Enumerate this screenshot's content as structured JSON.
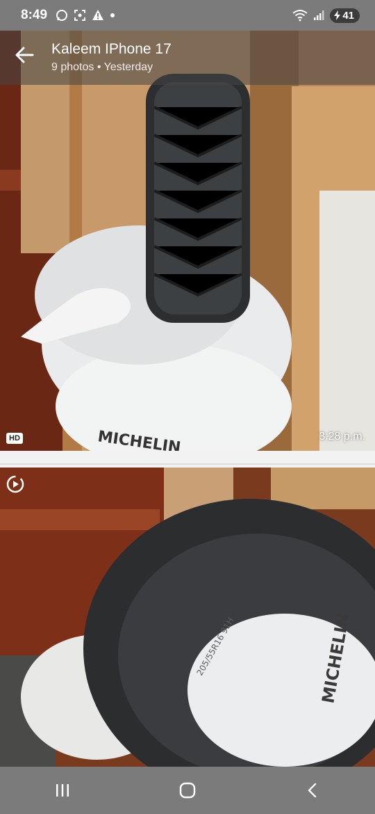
{
  "status_bar": {
    "time": "8:49",
    "battery": "41",
    "icons_left": [
      "whatsapp-icon",
      "screenshot-icon",
      "warning-icon",
      "dot-icon"
    ],
    "icons_right": [
      "wifi-icon",
      "signal-icon",
      "battery-icon"
    ]
  },
  "album": {
    "title": "Kaleem IPhone 17",
    "meta": "9 photos  •  Yesterday"
  },
  "photos": [
    {
      "badge": "HD",
      "time": "3:28 p.m.",
      "subject": "winter tire on bagged tires"
    },
    {
      "motion_icon": "motion-photo-icon",
      "subject": "tire closeup"
    }
  ],
  "nav": {
    "buttons": [
      "recents-icon",
      "home-icon",
      "back-icon"
    ]
  },
  "colors": {
    "bars": "#7b7b7b",
    "separator": "#f2f2f2"
  }
}
